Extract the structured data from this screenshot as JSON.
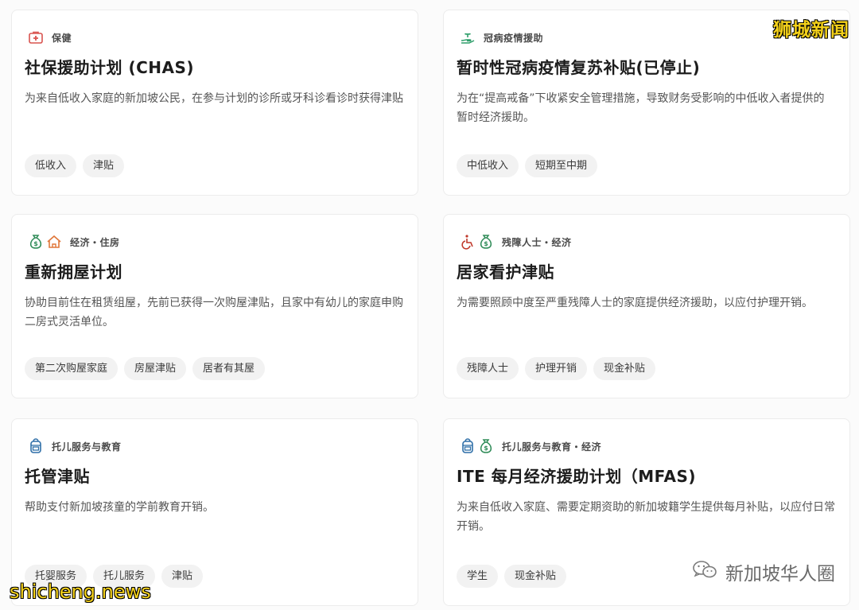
{
  "watermarks": {
    "top_right": "狮城新闻",
    "bottom_left": "shicheng.news",
    "wechat_account": "新加坡华人圈"
  },
  "cards": [
    {
      "icons": [
        "first-aid-kit-icon"
      ],
      "category": "保健",
      "title": "社保援助计划 (CHAS)",
      "description": "为来自低收入家庭的新加坡公民，在参与计划的诊所或牙科诊看诊时获得津贴",
      "tags": [
        "低收入",
        "津贴"
      ]
    },
    {
      "icons": [
        "hand-plant-icon"
      ],
      "category": "冠病疫情援助",
      "title": "暂时性冠病疫情复苏补贴(已停止)",
      "description": "为在“提高戒备”下收紧安全管理措施，导致财务受影响的中低收入者提供的暂时经济援助。",
      "tags": [
        "中低收入",
        "短期至中期"
      ]
    },
    {
      "icons": [
        "money-bag-icon",
        "house-icon"
      ],
      "category": "经济・住房",
      "title": "重新拥屋计划",
      "description": "协助目前住在租赁组屋，先前已获得一次购屋津贴，且家中有幼儿的家庭申购二房式灵活单位。",
      "tags": [
        "第二次购屋家庭",
        "房屋津贴",
        "居者有其屋"
      ]
    },
    {
      "icons": [
        "wheelchair-icon",
        "money-bag-icon"
      ],
      "category": "残障人士・经济",
      "title": "居家看护津贴",
      "description": "为需要照顾中度至严重残障人士的家庭提供经济援助，以应付护理开销。",
      "tags": [
        "残障人士",
        "护理开销",
        "现金补贴"
      ]
    },
    {
      "icons": [
        "backpack-icon"
      ],
      "category": "托儿服务与教育",
      "title": "托管津贴",
      "description": "帮助支付新加坡孩童的学前教育开销。",
      "tags": [
        "托婴服务",
        "托儿服务",
        "津贴"
      ]
    },
    {
      "icons": [
        "backpack-icon",
        "money-bag-icon"
      ],
      "category": "托儿服务与教育・经济",
      "title": "ITE 每月经济援助计划（MFAS)",
      "description": "为来自低收入家庭、需要定期资助的新加坡籍学生提供每月补贴，以应付日常开销。",
      "tags": [
        "学生",
        "现金补贴"
      ]
    }
  ],
  "colors": {
    "health_red": "#d9534f",
    "aid_green": "#2e9e6a",
    "money_green": "#2e8b57",
    "house_orange": "#e0773a",
    "disability_red": "#c0392b",
    "education_blue": "#2f6fa8",
    "watermark_yellow": "#f5d21b"
  }
}
